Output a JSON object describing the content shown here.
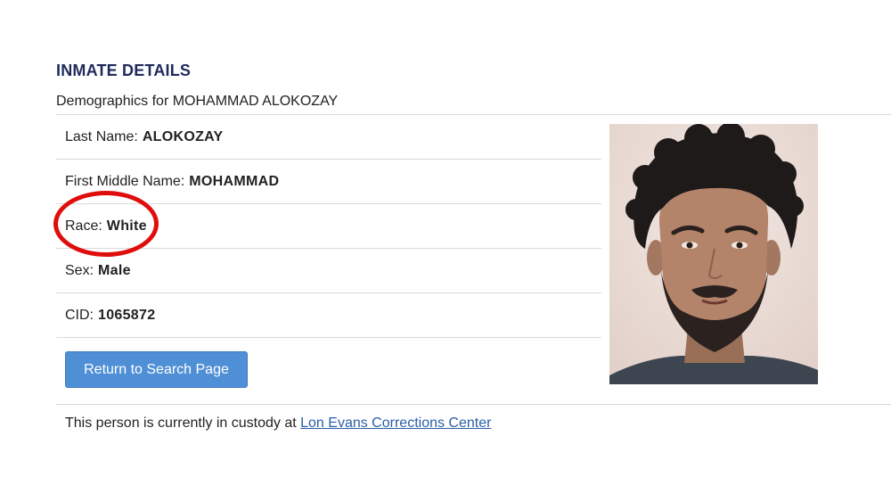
{
  "header": {
    "title": "INMATE DETAILS",
    "subtitle": "Demographics for MOHAMMAD ALOKOZAY"
  },
  "details": [
    {
      "label": "Last Name:",
      "value": "ALOKOZAY"
    },
    {
      "label": "First Middle Name:",
      "value": "MOHAMMAD"
    },
    {
      "label": "Race:",
      "value": "White"
    },
    {
      "label": "Sex:",
      "value": "Male"
    },
    {
      "label": "CID:",
      "value": "1065872"
    }
  ],
  "actions": {
    "return_label": "Return to Search Page"
  },
  "custody": {
    "text": "This person is currently in custody at",
    "facility_link": "Lon Evans Corrections Center"
  },
  "colors": {
    "heading": "#1f2a5c",
    "button": "#4f8fd6",
    "link": "#2a5ea8",
    "highlight_circle": "#e00d0d"
  },
  "icons": {
    "photo": "inmate-photo"
  }
}
